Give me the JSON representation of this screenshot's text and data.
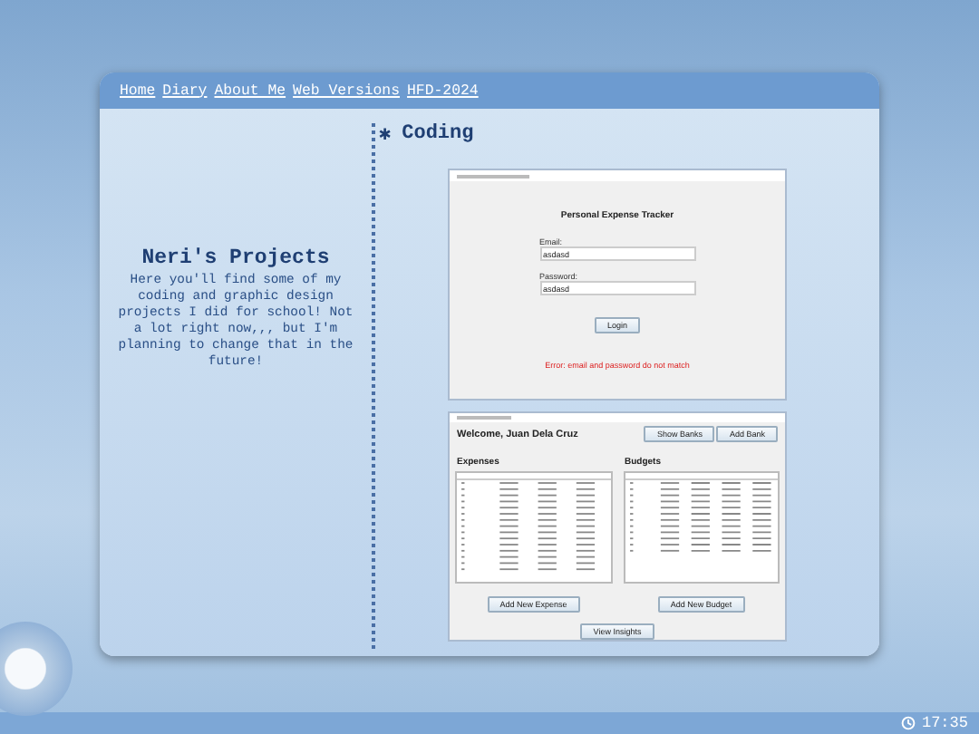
{
  "nav": [
    "Home",
    "Diary",
    "About Me",
    "Web Versions",
    "HFD-2024"
  ],
  "intro": {
    "title": "Neri's Projects",
    "text": "Here you'll find some of my coding and graphic design projects I did for school! Not a lot right now,,, but I'm planning to change that in the future!"
  },
  "section": {
    "marker": "✱",
    "title": "Coding"
  },
  "login_window": {
    "heading": "Personal Expense Tracker",
    "fields": [
      {
        "label": "Email:",
        "value": "asdasd"
      },
      {
        "label": "Password:",
        "value": "asdasd"
      }
    ],
    "button": "Login",
    "error": "Error: email and password do not match"
  },
  "main_window": {
    "welcome": "Welcome, Juan Dela Cruz",
    "buttons": [
      "Show Banks",
      "Add Bank"
    ],
    "panels": [
      {
        "title": "Expenses",
        "button": "Add New Expense"
      },
      {
        "title": "Budgets",
        "button": "Add New Budget"
      }
    ],
    "footer_button": "View Insights"
  },
  "clock": "17:35"
}
